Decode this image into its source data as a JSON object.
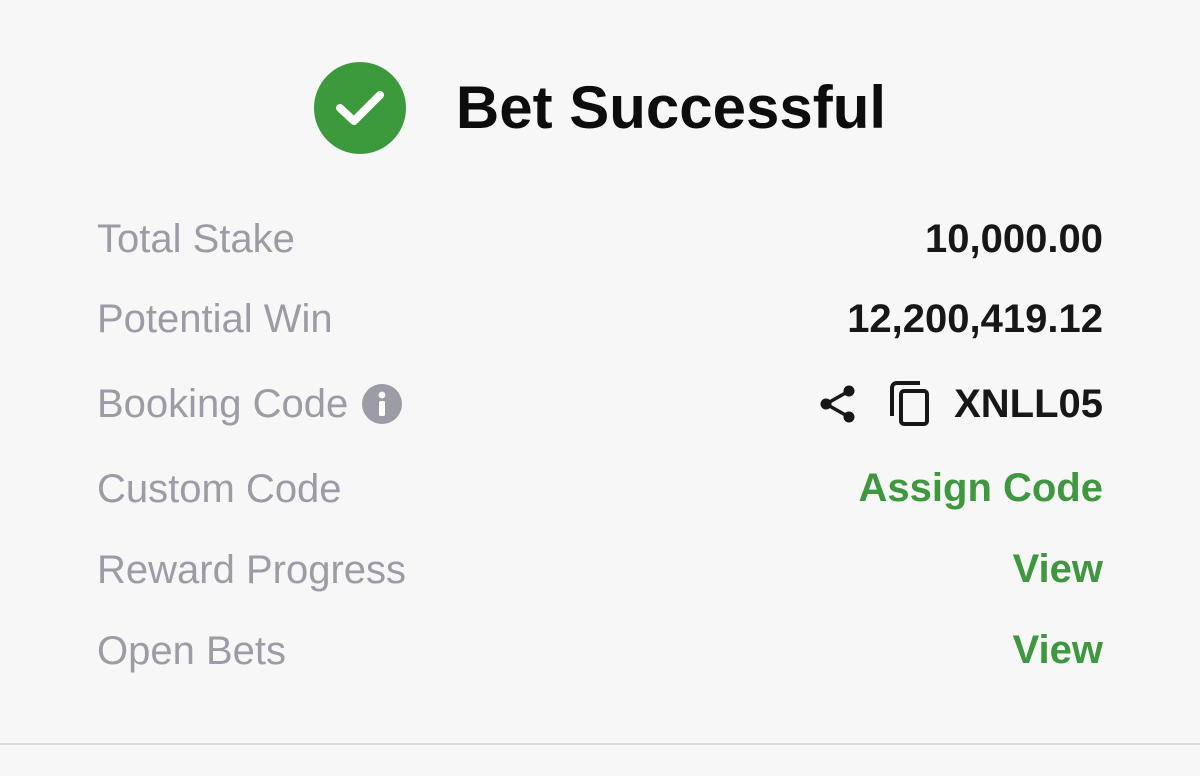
{
  "header": {
    "title": "Bet Successful",
    "icon": "check-circle-icon",
    "icon_color": "#3c9a3c"
  },
  "details": {
    "total_stake": {
      "label": "Total Stake",
      "value": "10,000.00"
    },
    "potential_win": {
      "label": "Potential Win",
      "value": "12,200,419.12"
    },
    "booking_code": {
      "label": "Booking Code",
      "value": "XNLL05",
      "info_icon": "info-icon",
      "share_icon": "share-icon",
      "copy_icon": "copy-icon"
    },
    "custom_code": {
      "label": "Custom Code",
      "action": "Assign Code"
    },
    "reward_progress": {
      "label": "Reward Progress",
      "action": "View"
    },
    "open_bets": {
      "label": "Open Bets",
      "action": "View"
    }
  },
  "colors": {
    "background": "#f7f7f8",
    "label_gray": "#9b9ca5",
    "value_dark": "#17171a",
    "link_green": "#3f973f"
  }
}
